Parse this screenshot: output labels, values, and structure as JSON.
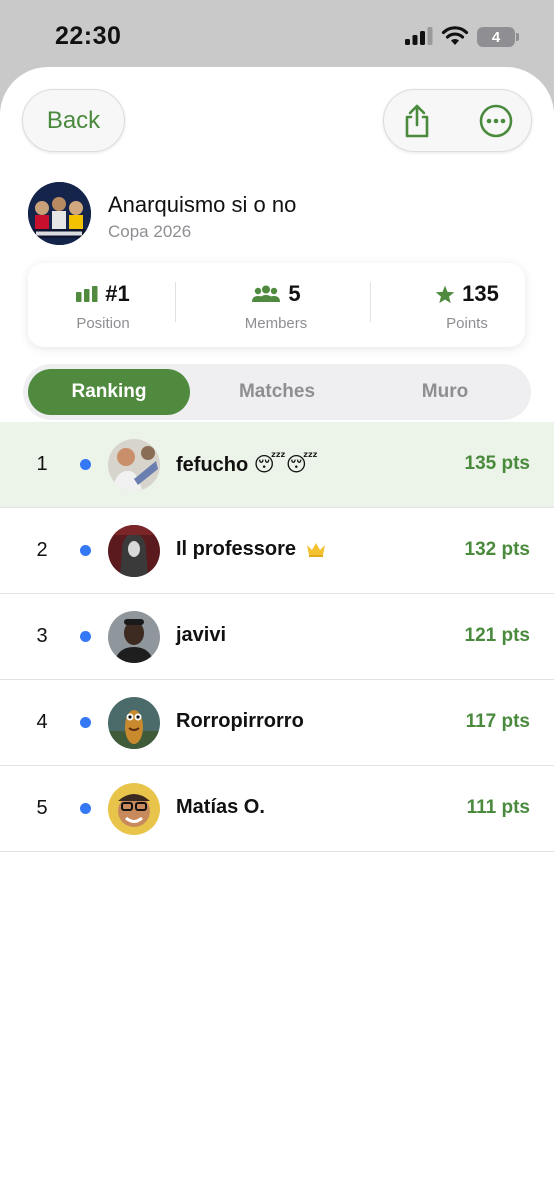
{
  "status_bar": {
    "time": "22:30",
    "battery": "4"
  },
  "header": {
    "back_label": "Back"
  },
  "group": {
    "title": "Anarquismo si o no",
    "subtitle": "Copa 2026"
  },
  "stats": [
    {
      "value": "#1",
      "label": "Position",
      "icon": "bar-chart-icon"
    },
    {
      "value": "5",
      "label": "Members",
      "icon": "people-icon"
    },
    {
      "value": "135",
      "label": "Points",
      "icon": "star-icon"
    }
  ],
  "tabs": [
    {
      "label": "Ranking",
      "active": true
    },
    {
      "label": "Matches",
      "active": false
    },
    {
      "label": "Muro",
      "active": false
    }
  ],
  "ranking": [
    {
      "rank": "1",
      "name": "fefucho 😴😴",
      "points": "135 pts"
    },
    {
      "rank": "2",
      "name": "Il professore",
      "points": "132 pts",
      "badge": "crown-icon"
    },
    {
      "rank": "3",
      "name": "javivi",
      "points": "121 pts"
    },
    {
      "rank": "4",
      "name": "Rorropirrorro",
      "points": "117 pts"
    },
    {
      "rank": "5",
      "name": "Matías O.",
      "points": "111 pts"
    }
  ],
  "colors": {
    "accent": "#4f8a3f",
    "online_dot": "#3478f6",
    "highlight_row": "#ecf3e8"
  }
}
